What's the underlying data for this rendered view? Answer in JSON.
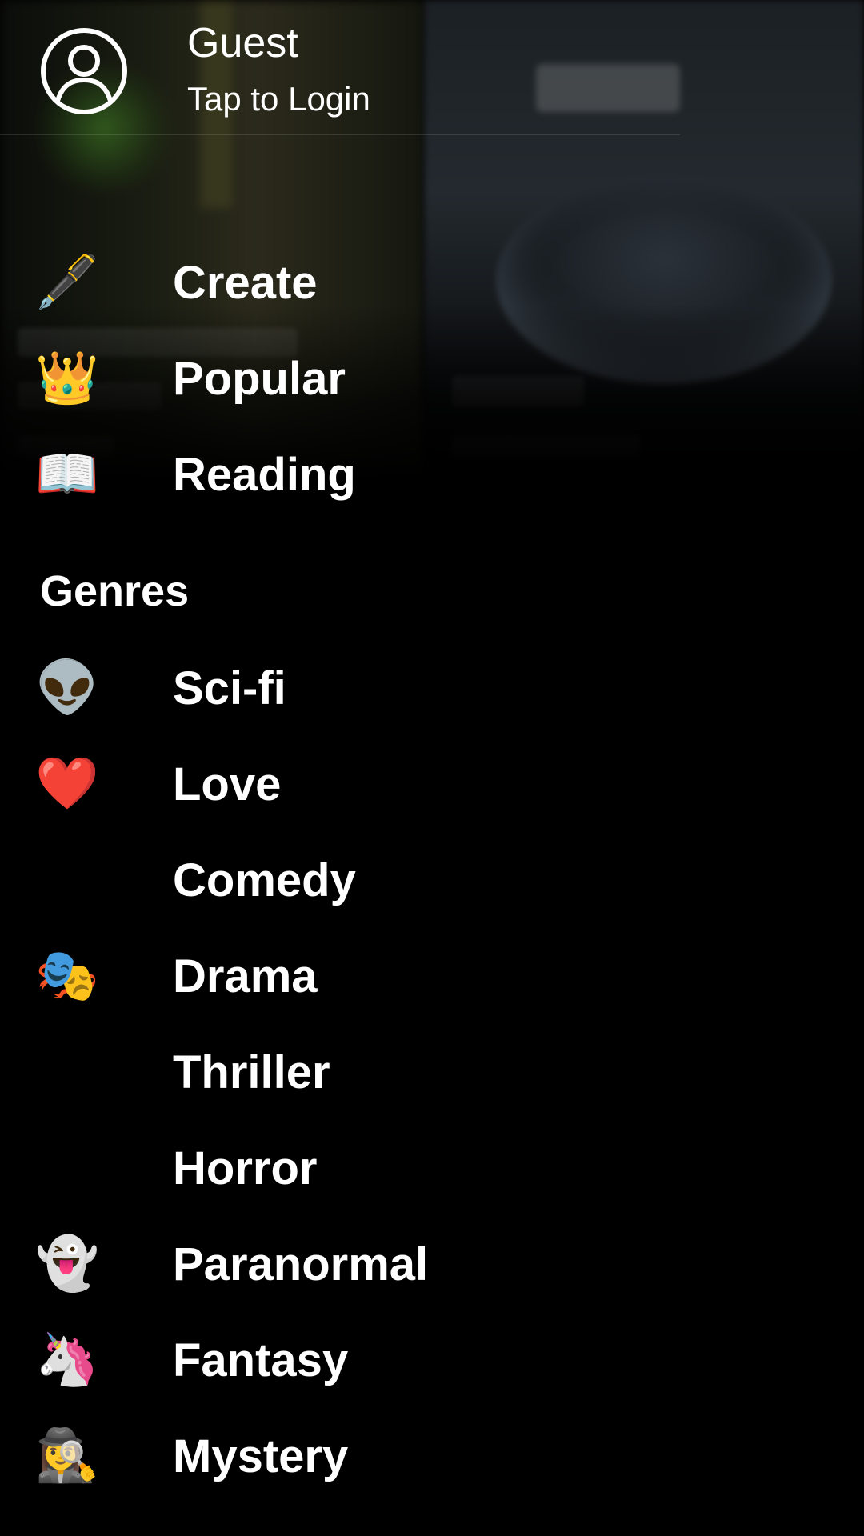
{
  "header": {
    "name": "Guest",
    "subtitle": "Tap to Login",
    "avatar_icon": "user-circle-icon"
  },
  "main_menu": [
    {
      "label": "Create",
      "icon": "🖋️",
      "icon_name": "fountain-pen-icon"
    },
    {
      "label": "Popular",
      "icon": "👑",
      "icon_name": "crown-icon"
    },
    {
      "label": "Reading",
      "icon": "📖",
      "icon_name": "open-book-icon"
    }
  ],
  "genres": {
    "title": "Genres",
    "items": [
      {
        "label": "Sci-fi",
        "icon": "👽",
        "icon_name": "alien-icon"
      },
      {
        "label": "Love",
        "icon": "❤️",
        "icon_name": "red-heart-icon"
      },
      {
        "label": "Comedy",
        "icon": "😂",
        "icon_name": "tears-of-joy-icon"
      },
      {
        "label": "Drama",
        "icon": "🎭",
        "icon_name": "theater-masks-icon"
      },
      {
        "label": "Thriller",
        "icon": "😯",
        "icon_name": "hushed-face-icon"
      },
      {
        "label": "Horror",
        "icon": "😱",
        "icon_name": "screaming-face-icon"
      },
      {
        "label": "Paranormal",
        "icon": "👻",
        "icon_name": "ghost-icon"
      },
      {
        "label": "Fantasy",
        "icon": "🦄",
        "icon_name": "unicorn-icon"
      },
      {
        "label": "Mystery",
        "icon": "🕵️‍♀️",
        "icon_name": "detective-icon"
      }
    ]
  },
  "colors": {
    "background": "#000000",
    "text": "#ffffff"
  }
}
